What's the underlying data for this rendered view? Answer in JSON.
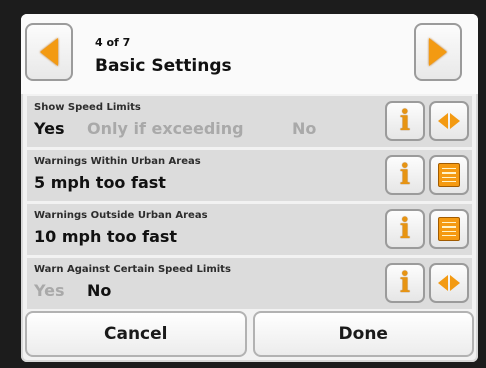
{
  "header": {
    "counter": "4 of 7",
    "title": "Basic Settings"
  },
  "rows": [
    {
      "label": "Show Speed Limits",
      "options": [
        {
          "text": "Yes",
          "selected": true
        },
        {
          "text": "Only if exceeding",
          "selected": false
        },
        {
          "text": "No",
          "selected": false
        }
      ],
      "control": "toggle-icon"
    },
    {
      "label": "Warnings Within Urban Areas",
      "value": "5 mph too fast",
      "control": "list-icon"
    },
    {
      "label": "Warnings Outside Urban Areas",
      "value": "10 mph too fast",
      "control": "list-icon"
    },
    {
      "label": "Warn Against Certain Speed Limits",
      "options": [
        {
          "text": "Yes",
          "selected": false
        },
        {
          "text": "No",
          "selected": true
        }
      ],
      "control": "toggle-icon"
    }
  ],
  "footer": {
    "cancel_label": "Cancel",
    "done_label": "Done"
  },
  "colors": {
    "accent": "#f39a12",
    "selected_text": "#111111",
    "unselected_text": "#a9a9a9"
  }
}
